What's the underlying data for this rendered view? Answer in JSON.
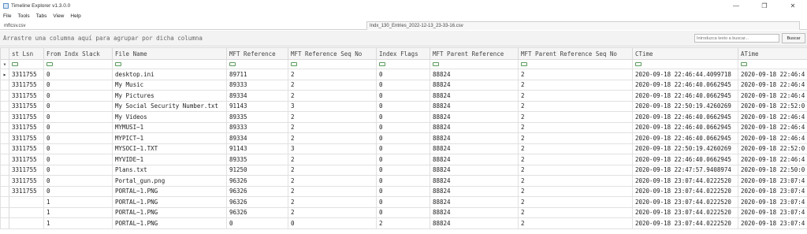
{
  "window": {
    "title": "Timeline Explorer v1.3.0.0",
    "minimize": "—",
    "maximize": "❐",
    "close": "✕"
  },
  "menu": [
    "File",
    "Tools",
    "Tabs",
    "View",
    "Help"
  ],
  "tabs": {
    "left": "mftcsv.csv",
    "right": "Indx_130_Entries_2022-12-13_23-33-16.csv"
  },
  "group_hint": "Arrastre una columna aquí para agrupar por dicha columna",
  "search": {
    "placeholder": "Introduzca texto a buscar...",
    "button": "Buscar"
  },
  "row_indicator": "▸",
  "filter_glyph": "▾",
  "columns": [
    "st Lsn",
    "From Indx Slack",
    "File Name",
    "MFT Reference",
    "MFT Reference Seq No",
    "Index Flags",
    "MFT Parent Reference",
    "MFT Parent Reference Seq No",
    "CTime",
    "ATime"
  ],
  "rows": [
    [
      "3311755",
      "0",
      "desktop.ini",
      "89711",
      "2",
      "0",
      "88824",
      "2",
      "2020-09-18 22:46:44.4099718",
      "2020-09-18 22:46:4"
    ],
    [
      "3311755",
      "0",
      "My Music",
      "89333",
      "2",
      "0",
      "88824",
      "2",
      "2020-09-18 22:46:40.0662945",
      "2020-09-18 22:46:4"
    ],
    [
      "3311755",
      "0",
      "My Pictures",
      "89334",
      "2",
      "0",
      "88824",
      "2",
      "2020-09-18 22:46:40.0662945",
      "2020-09-18 22:46:4"
    ],
    [
      "3311755",
      "0",
      "My Social Security Number.txt",
      "91143",
      "3",
      "0",
      "88824",
      "2",
      "2020-09-18 22:50:19.4260269",
      "2020-09-18 22:52:0"
    ],
    [
      "3311755",
      "0",
      "My Videos",
      "89335",
      "2",
      "0",
      "88824",
      "2",
      "2020-09-18 22:46:40.0662945",
      "2020-09-18 22:46:4"
    ],
    [
      "3311755",
      "0",
      "MYMUSI~1",
      "89333",
      "2",
      "0",
      "88824",
      "2",
      "2020-09-18 22:46:40.0662945",
      "2020-09-18 22:46:4"
    ],
    [
      "3311755",
      "0",
      "MYPICT~1",
      "89334",
      "2",
      "0",
      "88824",
      "2",
      "2020-09-18 22:46:40.0662945",
      "2020-09-18 22:46:4"
    ],
    [
      "3311755",
      "0",
      "MYSOCI~1.TXT",
      "91143",
      "3",
      "0",
      "88824",
      "2",
      "2020-09-18 22:50:19.4260269",
      "2020-09-18 22:52:0"
    ],
    [
      "3311755",
      "0",
      "MYVIDE~1",
      "89335",
      "2",
      "0",
      "88824",
      "2",
      "2020-09-18 22:46:40.0662945",
      "2020-09-18 22:46:4"
    ],
    [
      "3311755",
      "0",
      "Plans.txt",
      "91250",
      "2",
      "0",
      "88824",
      "2",
      "2020-09-18 22:47:57.9408974",
      "2020-09-18 22:50:0"
    ],
    [
      "3311755",
      "0",
      "Portal_gun.png",
      "96326",
      "2",
      "0",
      "88824",
      "2",
      "2020-09-18 23:07:44.0222520",
      "2020-09-18 23:07:4"
    ],
    [
      "3311755",
      "0",
      "PORTAL~1.PNG",
      "96326",
      "2",
      "0",
      "88824",
      "2",
      "2020-09-18 23:07:44.0222520",
      "2020-09-18 23:07:4"
    ],
    [
      "",
      "1",
      "PORTAL~1.PNG",
      "96326",
      "2",
      "0",
      "88824",
      "2",
      "2020-09-18 23:07:44.0222520",
      "2020-09-18 23:07:4"
    ],
    [
      "",
      "1",
      "PORTAL~1.PNG",
      "96326",
      "2",
      "0",
      "88824",
      "2",
      "2020-09-18 23:07:44.0222520",
      "2020-09-18 23:07:4"
    ],
    [
      "",
      "1",
      "PORTAL~1.PNG",
      "0",
      "0",
      "2",
      "88824",
      "2",
      "2020-09-18 23:07:44.0222520",
      "2020-09-18 23:07:4"
    ]
  ]
}
